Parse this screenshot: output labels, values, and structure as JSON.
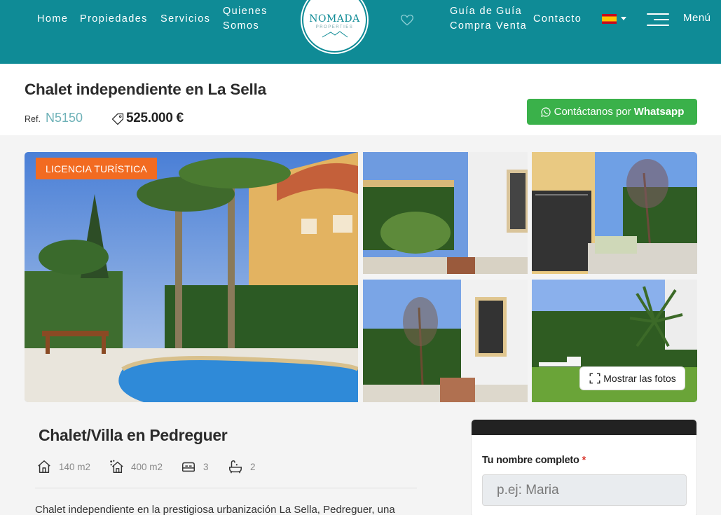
{
  "nav": {
    "home": "Home",
    "propiedades": "Propiedades",
    "servicios": "Servicios",
    "quienes_line1": "Quienes",
    "quienes_line2": "Somos",
    "guia_compra_line1": "Guía de",
    "guia_compra_line2": "Compra",
    "guia_venta_line1": "Guía",
    "guia_venta_line2": "Venta",
    "contacto": "Contacto",
    "menu": "Menú"
  },
  "logo": {
    "name": "NOMADA",
    "sub": "PROPERTIES"
  },
  "property": {
    "title": "Chalet independiente en La Sella",
    "ref_label": "Ref.",
    "ref": "N5150",
    "price": "525.000 €",
    "whatsapp_prefix": "Contáctanos por",
    "whatsapp_bold": "Whatsapp",
    "badge": "LICENCIA TURÍSTICA",
    "show_photos": "Mostrar las fotos",
    "subtitle": "Chalet/Villa en Pedreguer",
    "features": {
      "built": "140 m2",
      "plot": "400 m2",
      "bedrooms": "3",
      "bathrooms": "2"
    },
    "description": "Chalet independiente en la prestigiosa urbanización La Sella, Pedreguer, una"
  },
  "form": {
    "name_label": "Tu nombre completo",
    "required_mark": "*",
    "name_placeholder": "p.ej: Maria"
  },
  "colors": {
    "header": "#0f8b96",
    "accent": "#6fb2b8",
    "whatsapp": "#3ab14a",
    "badge": "#f26b21"
  }
}
